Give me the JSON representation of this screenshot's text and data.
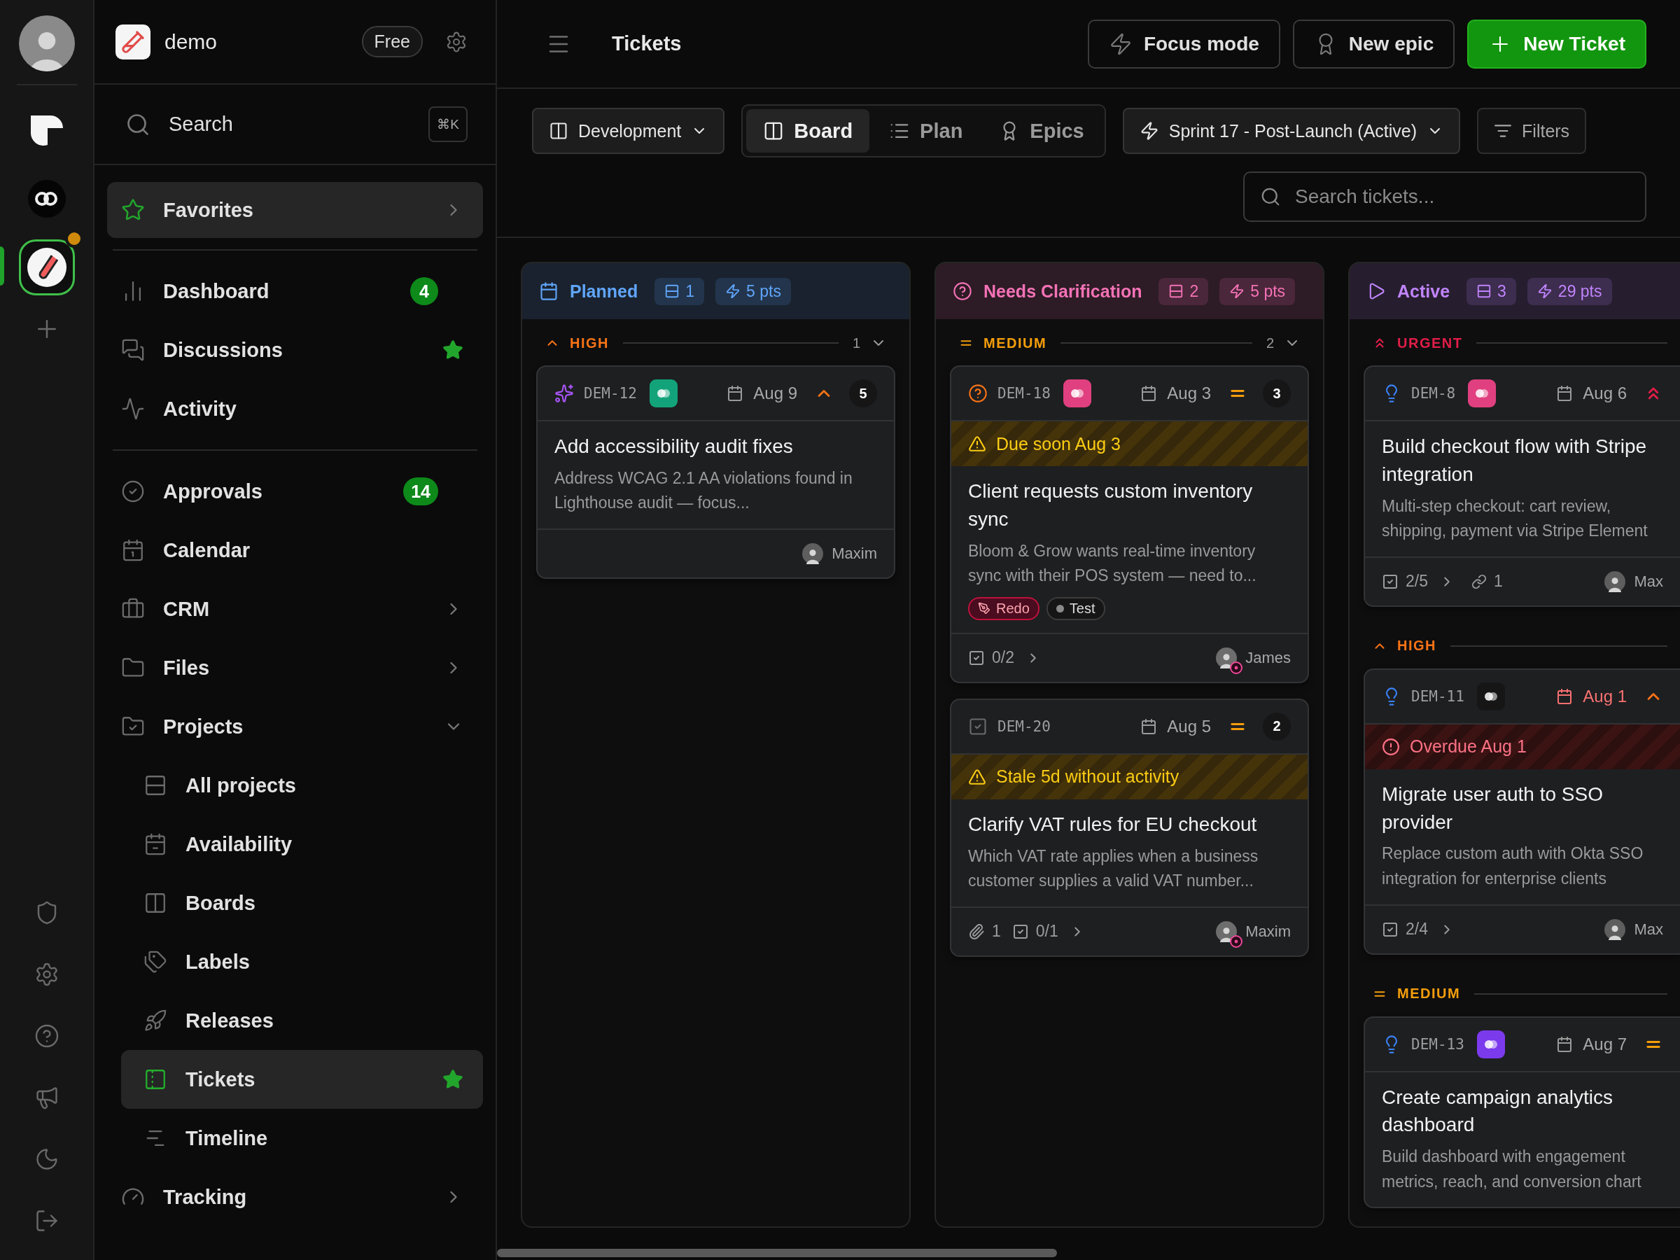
{
  "rail": {
    "workspaces": [
      {
        "selected": false,
        "notification": false
      },
      {
        "selected": false,
        "notification": false
      },
      {
        "selected": true,
        "notification": true
      }
    ]
  },
  "sidebar": {
    "workspace": "demo",
    "plan": "Free",
    "search": {
      "label": "Search",
      "shortcut": "⌘K"
    },
    "favorites": {
      "label": "Favorites",
      "expanded": false
    },
    "groups": [
      [
        {
          "label": "Dashboard",
          "badge": "4",
          "starred": false,
          "selected": false
        },
        {
          "label": "Discussions",
          "starred": true,
          "selected": false
        },
        {
          "label": "Activity",
          "starred": false,
          "selected": false
        }
      ],
      [
        {
          "label": "Approvals",
          "badge": "14",
          "starred": false,
          "selected": false
        },
        {
          "label": "Calendar",
          "starred": false,
          "selected": false
        },
        {
          "label": "CRM",
          "expanded": false,
          "starred": false,
          "selected": false
        },
        {
          "label": "Files",
          "expanded": false,
          "starred": false,
          "selected": false
        },
        {
          "label": "Projects",
          "expanded": true,
          "starred": false,
          "selected": false,
          "children": [
            {
              "label": "All projects",
              "starred": false,
              "selected": false
            },
            {
              "label": "Availability",
              "starred": false,
              "selected": false
            },
            {
              "label": "Boards",
              "starred": false,
              "selected": false
            },
            {
              "label": "Labels",
              "starred": false,
              "selected": false
            },
            {
              "label": "Releases",
              "starred": false,
              "selected": false
            },
            {
              "label": "Tickets",
              "starred": true,
              "selected": true
            },
            {
              "label": "Timeline",
              "starred": false,
              "selected": false
            }
          ]
        },
        {
          "label": "Tracking",
          "expanded": false,
          "starred": false,
          "selected": false
        }
      ]
    ]
  },
  "header": {
    "title": "Tickets",
    "actions": [
      {
        "label": "Focus mode",
        "kind": "outline"
      },
      {
        "label": "New epic",
        "kind": "outline"
      },
      {
        "label": "New Ticket",
        "kind": "primary"
      }
    ]
  },
  "toolbar": {
    "board": "Development",
    "views": [
      {
        "label": "Board",
        "selected": true
      },
      {
        "label": "Plan",
        "selected": false
      },
      {
        "label": "Epics",
        "selected": false
      }
    ],
    "sprint": "Sprint 17 - Post-Launch (Active)",
    "filters": "Filters",
    "search": {
      "placeholder": "Search tickets..."
    }
  },
  "columns": [
    {
      "title": "Planned",
      "color": "#60a5fa",
      "count": "1",
      "points": "5 pts",
      "groups": [
        {
          "kind": "high",
          "label": "HIGH",
          "count": "1",
          "expanded": true,
          "cards": [
            {
              "kind": "feature",
              "id": "DEM-12",
              "color": "#13a37a",
              "date": "Aug 9",
              "overdue": false,
              "priority": {
                "kind": "high"
              },
              "points": "5",
              "title": "Add accessibility audit fixes",
              "description": "Address WCAG 2.1 AA violations found in Lighthouse audit — focus...",
              "footer": {
                "assignee": "Maxim",
                "assignee_badge": false
              }
            }
          ]
        }
      ]
    },
    {
      "title": "Needs Clarification",
      "color": "#f472b6",
      "count": "2",
      "points": "5 pts",
      "groups": [
        {
          "kind": "medium",
          "label": "MEDIUM",
          "count": "2",
          "expanded": true,
          "cards": [
            {
              "kind": "question",
              "id": "DEM-18",
              "color": "#e0407f",
              "date": "Aug 3",
              "overdue": false,
              "priority": {
                "kind": "medium"
              },
              "points": "3",
              "alert": {
                "kind": "warning",
                "text": "Due soon Aug 3"
              },
              "title": "Client requests custom inventory sync",
              "description": "Bloom & Grow wants real-time inventory sync with their POS system — need to...",
              "tags": [
                {
                  "label": "Redo",
                  "kind": "redo"
                },
                {
                  "label": "Test",
                  "kind": "plain"
                }
              ],
              "footer": {
                "subtasks": "0/2",
                "assignee": "James",
                "assignee_badge": true
              }
            },
            {
              "kind": "task",
              "id": "DEM-20",
              "date": "Aug 5",
              "overdue": false,
              "priority": {
                "kind": "medium"
              },
              "points": "2",
              "alert": {
                "kind": "warning",
                "text": "Stale 5d without activity"
              },
              "title": "Clarify VAT rules for EU checkout",
              "description": "Which VAT rate applies when a business customer supplies a valid VAT number...",
              "footer": {
                "attachments": "1",
                "subtasks": "0/1",
                "assignee": "Maxim",
                "assignee_badge": true
              }
            }
          ]
        }
      ]
    },
    {
      "title": "Active",
      "color": "#c084fc",
      "count": "3",
      "points": "29 pts",
      "groups": [
        {
          "kind": "urgent",
          "label": "URGENT",
          "cards": [
            {
              "kind": "idea",
              "id": "DEM-8",
              "color": "#e0407f",
              "date": "Aug 6",
              "overdue": false,
              "priority": {
                "kind": "urgent"
              },
              "title": "Build checkout flow with Stripe integration",
              "description": "Multi-step checkout: cart review, shipping, payment via Stripe Element",
              "footer": {
                "subtasks": "2/5",
                "links": "1",
                "assignee": "Max",
                "assignee_badge": false
              }
            }
          ]
        },
        {
          "kind": "high",
          "label": "HIGH",
          "cards": [
            {
              "kind": "idea",
              "id": "DEM-11",
              "color": "#161616",
              "date": "Aug 1",
              "overdue": true,
              "priority": {
                "kind": "high"
              },
              "alert": {
                "kind": "overdue",
                "text": "Overdue Aug 1"
              },
              "title": "Migrate user auth to SSO provider",
              "description": "Replace custom auth with Okta SSO integration for enterprise clients",
              "footer": {
                "subtasks": "2/4",
                "assignee": "Max",
                "assignee_badge": false
              }
            }
          ]
        },
        {
          "kind": "medium",
          "label": "MEDIUM",
          "cards": [
            {
              "kind": "idea",
              "id": "DEM-13",
              "color": "#7c3aed",
              "date": "Aug 7",
              "overdue": false,
              "priority": {
                "kind": "medium"
              },
              "title": "Create campaign analytics dashboard",
              "description": "Build dashboard with engagement metrics, reach, and conversion chart"
            }
          ]
        }
      ]
    }
  ]
}
